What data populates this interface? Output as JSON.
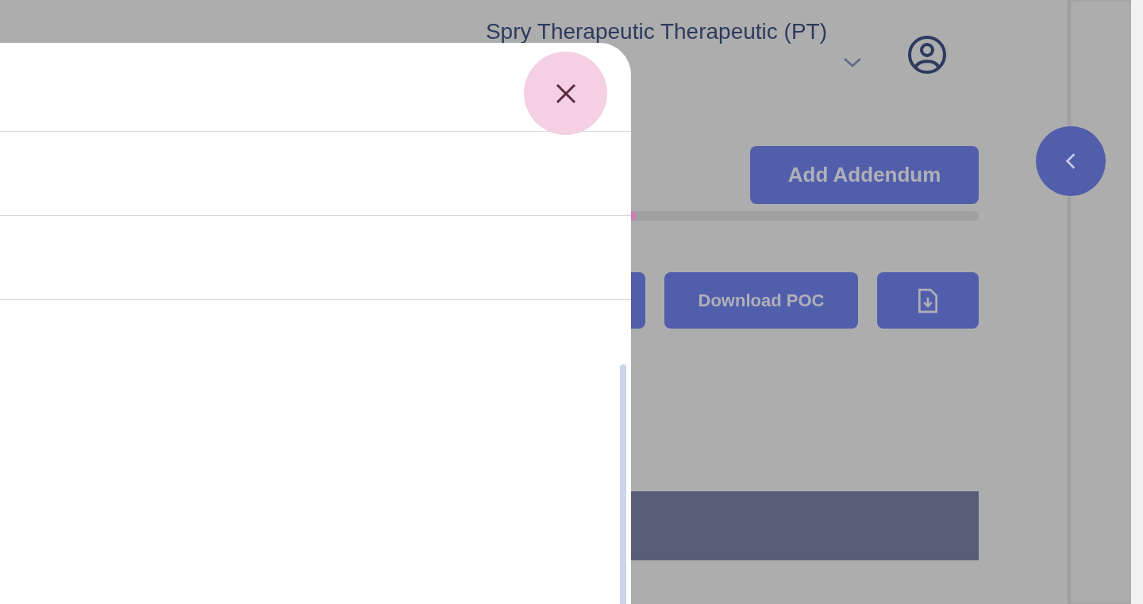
{
  "header": {
    "title": "Spry Therapeutic Therapeutic (PT)"
  },
  "add_addendum_button": {
    "label": "Add Addendum"
  },
  "progress": {
    "level": 0
  },
  "actions": [
    {
      "kind": "partial"
    },
    {
      "kind": "text",
      "label": "Download POC"
    },
    {
      "kind": "icon"
    }
  ]
}
